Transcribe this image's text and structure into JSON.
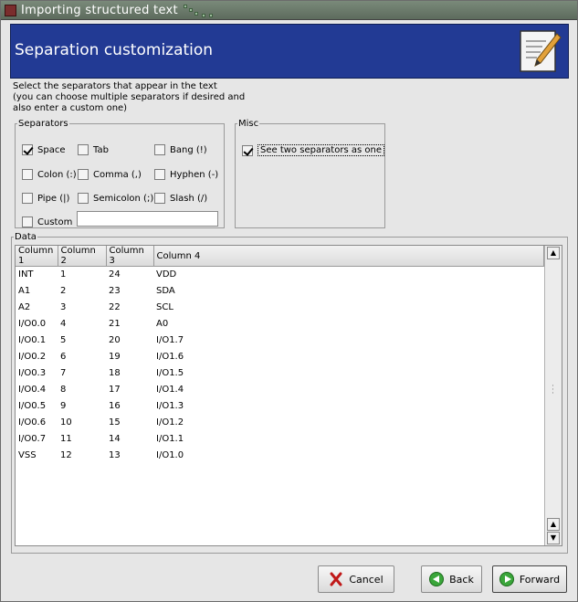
{
  "window": {
    "title": "Importing structured text"
  },
  "banner": {
    "title": "Separation customization"
  },
  "intro": {
    "line1": "Select the separators that appear in the text",
    "line2": "(you can choose multiple separators if desired and",
    "line3": "also enter a custom one)"
  },
  "separators": {
    "legend": "Separators",
    "space": {
      "label": "Space",
      "checked": true
    },
    "tab": {
      "label": "Tab",
      "checked": false
    },
    "bang": {
      "label": "Bang (!)",
      "checked": false
    },
    "colon": {
      "label": "Colon (:)",
      "checked": false
    },
    "comma": {
      "label": "Comma (,)",
      "checked": false
    },
    "hyphen": {
      "label": "Hyphen (-)",
      "checked": false
    },
    "pipe": {
      "label": "Pipe (|)",
      "checked": false
    },
    "semicolon": {
      "label": "Semicolon (;)",
      "checked": false
    },
    "slash": {
      "label": "Slash (/)",
      "checked": false
    },
    "custom": {
      "label": "Custom",
      "checked": false,
      "value": ""
    }
  },
  "misc": {
    "legend": "Misc",
    "two_as_one": {
      "label": "See two separators as one",
      "checked": true
    }
  },
  "data": {
    "legend": "Data",
    "columns": [
      "Column 1",
      "Column 2",
      "Column 3",
      "Column 4"
    ],
    "rows": [
      [
        "INT",
        "1",
        "24",
        "VDD"
      ],
      [
        "A1",
        "2",
        "23",
        "SDA"
      ],
      [
        "A2",
        "3",
        "22",
        "SCL"
      ],
      [
        "I/O0.0",
        "4",
        "21",
        "A0"
      ],
      [
        "I/O0.1",
        "5",
        "20",
        "I/O1.7"
      ],
      [
        "I/O0.2",
        "6",
        "19",
        "I/O1.6"
      ],
      [
        "I/O0.3",
        "7",
        "18",
        "I/O1.5"
      ],
      [
        "I/O0.4",
        "8",
        "17",
        "I/O1.4"
      ],
      [
        "I/O0.5",
        "9",
        "16",
        "I/O1.3"
      ],
      [
        "I/O0.6",
        "10",
        "15",
        "I/O1.2"
      ],
      [
        "I/O0.7",
        "11",
        "14",
        "I/O1.1"
      ],
      [
        "VSS",
        "12",
        "13",
        "I/O1.0"
      ]
    ]
  },
  "buttons": {
    "cancel": "Cancel",
    "back": "Back",
    "forward": "Forward"
  },
  "icons": {
    "app": "app-icon",
    "wizard": "notepad-pencil-icon",
    "cancel": "red-x-icon",
    "back": "green-back-arrow-icon",
    "forward": "green-forward-arrow-icon"
  }
}
